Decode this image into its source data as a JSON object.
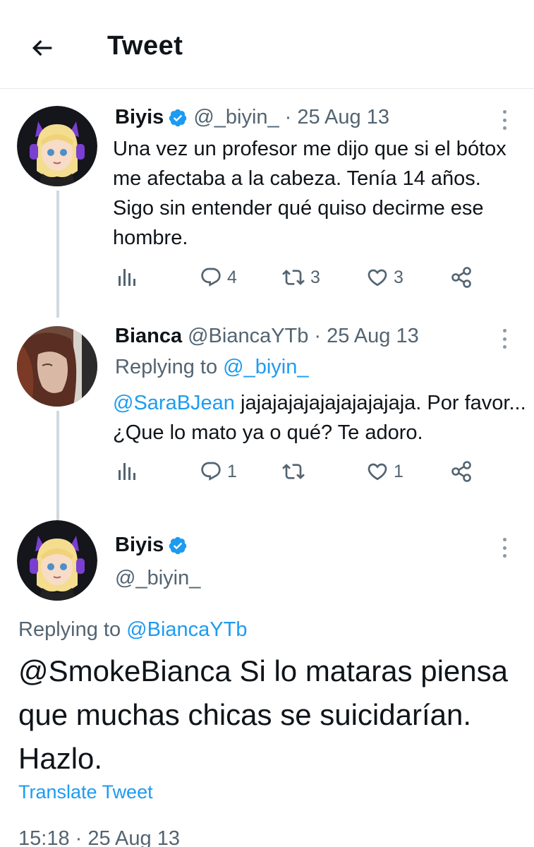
{
  "header": {
    "title": "Tweet"
  },
  "tweets": [
    {
      "name": "Biyis",
      "handle": "@_biyin_",
      "date": "25 Aug 13",
      "text": "Una vez un profesor me dijo que si el bótox me afectaba a la cabeza. Tenía 14 años. Sigo sin entender qué quiso decirme ese hombre.",
      "replies": "4",
      "retweets": "3",
      "likes": "3"
    },
    {
      "name": "Bianca",
      "handle": "@BiancaYTb",
      "date": "25 Aug 13",
      "replying_label": "Replying to",
      "replying_to": "@_biyin_",
      "mention": "@SaraBJean",
      "text": " jajajajajajajajajajaja. Por favor... ¿Que lo mato ya o qué? Te adoro.",
      "replies": "1",
      "retweets": "",
      "likes": "1"
    }
  ],
  "main": {
    "name": "Biyis",
    "handle": "@_biyin_",
    "replying_label": "Replying to",
    "replying_to": "@BiancaYTb",
    "mention": "@SmokeBianca",
    "text": " Si lo mataras piensa que muchas chicas se suicidarían. Hazlo.",
    "translate": "Translate Tweet",
    "timestamp": "15:18 · 25 Aug 13"
  },
  "colors": {
    "accent": "#1d9bf0",
    "muted": "#536471",
    "text": "#0f1419",
    "thread": "#cfd9de"
  }
}
